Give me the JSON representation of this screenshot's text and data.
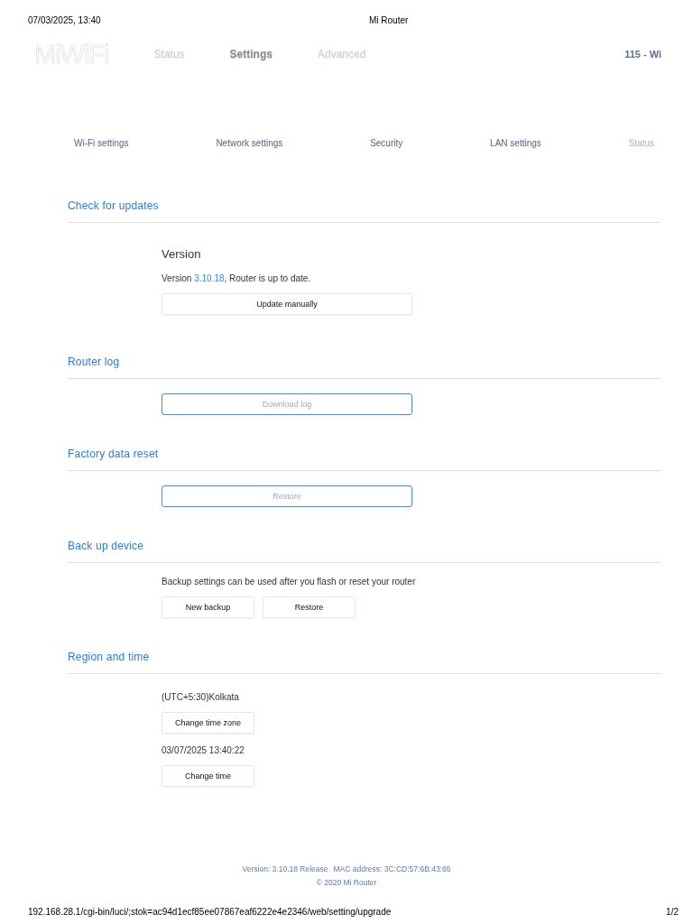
{
  "print_header": {
    "date": "07/03/2025, 13:40",
    "title": "Mi Router"
  },
  "nav": {
    "logo": "MiWiFi",
    "tabs": [
      {
        "label": "Status",
        "selected": false
      },
      {
        "label": "Settings",
        "selected": true
      },
      {
        "label": "Advanced",
        "selected": false
      }
    ],
    "device": "115 - Wi"
  },
  "subnav": [
    {
      "label": "Wi-Fi settings",
      "disabled": false
    },
    {
      "label": "Network settings",
      "disabled": false
    },
    {
      "label": "Security",
      "disabled": false
    },
    {
      "label": "LAN settings",
      "disabled": false
    },
    {
      "label": "Status",
      "disabled": true
    }
  ],
  "sections": [
    {
      "title": "Check for updates",
      "blocks": [
        {
          "kind": "subtitle",
          "text": "Version"
        },
        {
          "kind": "status",
          "before": "Version ",
          "link": "3.10.18",
          "after": ", Router is up to date."
        },
        {
          "kind": "buttons",
          "buttons": [
            {
              "label": "Update manually",
              "kind": "wide"
            }
          ]
        }
      ]
    },
    {
      "title": "Router log",
      "blocks": [
        {
          "kind": "buttons",
          "buttons": [
            {
              "label": "Download log",
              "kind": "outlined"
            }
          ]
        }
      ]
    },
    {
      "title": "Factory data reset",
      "blocks": [
        {
          "kind": "buttons",
          "buttons": [
            {
              "label": "Restore",
              "kind": "outlined"
            }
          ]
        }
      ]
    },
    {
      "title": "Back up device",
      "blocks": [
        {
          "kind": "text",
          "text": "Backup settings can be used after you flash or reset your router"
        },
        {
          "kind": "buttons",
          "buttons": [
            {
              "label": "New backup",
              "kind": "compact"
            },
            {
              "label": "Restore",
              "kind": "compact"
            }
          ]
        }
      ]
    },
    {
      "title": "Region and time",
      "blocks": [
        {
          "kind": "text",
          "text": "(UTC+5:30)Kolkata"
        },
        {
          "kind": "buttons",
          "buttons": [
            {
              "label": "Change time zone",
              "kind": "compact"
            }
          ]
        },
        {
          "kind": "text",
          "text": "03/07/2025 13:40:22"
        },
        {
          "kind": "buttons",
          "buttons": [
            {
              "label": "Change time",
              "kind": "compact"
            }
          ]
        }
      ]
    }
  ],
  "footer": {
    "version": "Version: 3.10.18 Release",
    "mac": "MAC address: 3C:CD:57:6B:43:65",
    "copyright": "© 2020 Mi Router"
  },
  "print_footer": {
    "url": "192.168.28.1/cgi-bin/luci/;stok=ac94d1ecf85ee07867eaf6222e4e2346/web/setting/upgrade",
    "page": "1/2"
  }
}
